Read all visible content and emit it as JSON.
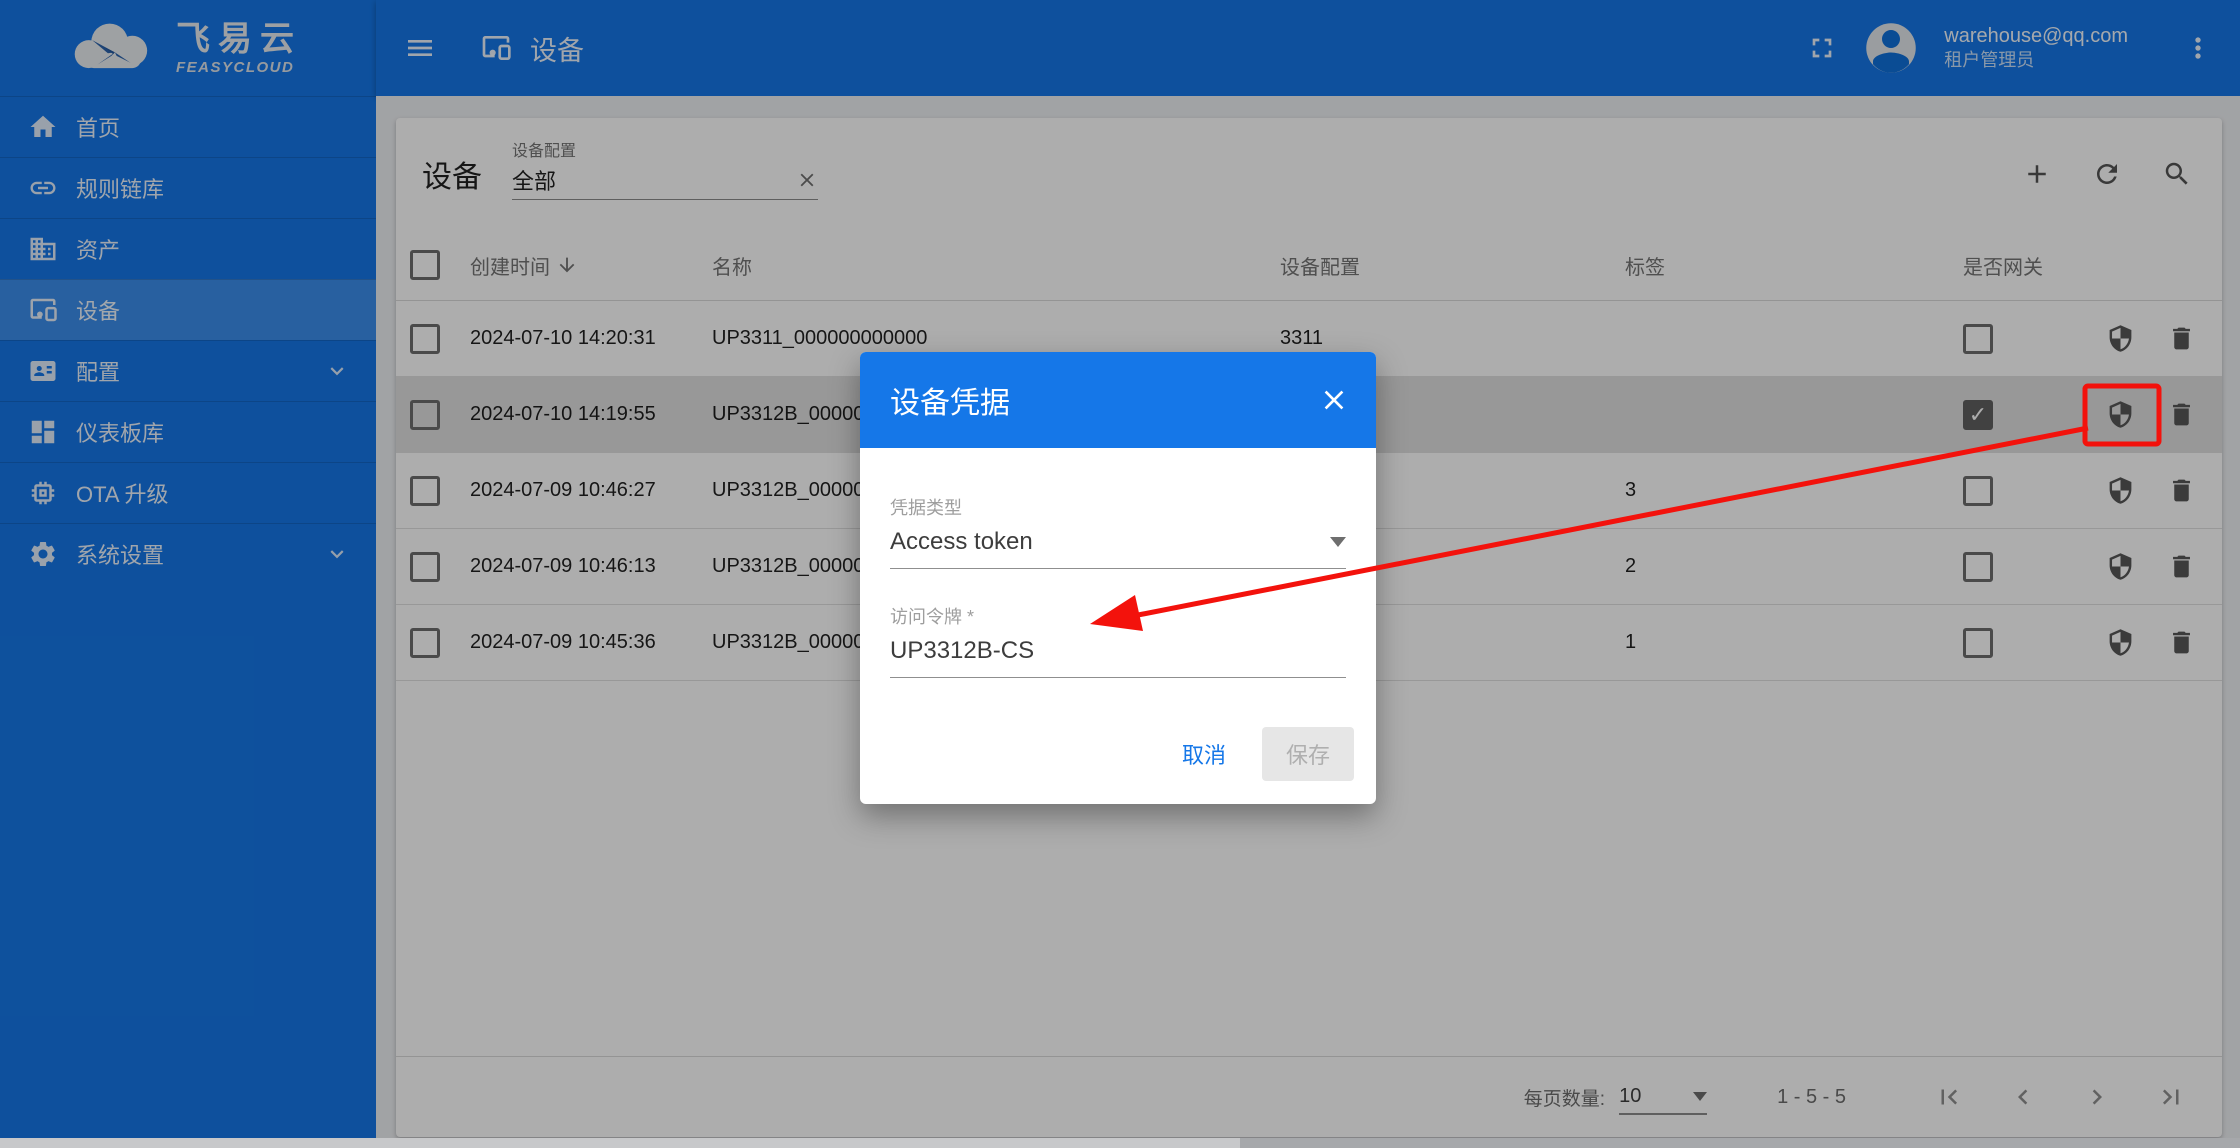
{
  "colors": {
    "primary": "#1577E8",
    "backdrop": "rgba(0,0,0,0.32)",
    "annotation_red": "#F3120C",
    "selected_row": "#E0E0E0"
  },
  "brand": {
    "logo_cn": "飞易云",
    "logo_en": "FEASYCLOUD"
  },
  "topbar": {
    "title": "设备",
    "user": {
      "email": "warehouse@qq.com",
      "role": "租户管理员"
    }
  },
  "sidebar": {
    "items": [
      {
        "label": "首页",
        "icon": "home-icon",
        "active": false,
        "expandable": false
      },
      {
        "label": "规则链库",
        "icon": "link-icon",
        "active": false,
        "expandable": false
      },
      {
        "label": "资产",
        "icon": "domain-icon",
        "active": false,
        "expandable": false
      },
      {
        "label": "设备",
        "icon": "devices-icon",
        "active": true,
        "expandable": false
      },
      {
        "label": "配置",
        "icon": "badge-icon",
        "active": false,
        "expandable": true
      },
      {
        "label": "仪表板库",
        "icon": "dashboard-icon",
        "active": false,
        "expandable": false
      },
      {
        "label": "OTA 升级",
        "icon": "memory-icon",
        "active": false,
        "expandable": false
      },
      {
        "label": "系统设置",
        "icon": "settings-icon",
        "active": false,
        "expandable": true
      }
    ]
  },
  "main": {
    "title": "设备",
    "filter": {
      "label": "设备配置",
      "value": "全部"
    },
    "table": {
      "columns": {
        "created": "创建时间",
        "name": "名称",
        "profile": "设备配置",
        "label": "标签",
        "gateway": "是否网关"
      },
      "sort_column": "创建时间",
      "rows": [
        {
          "created": "2024-07-10 14:20:31",
          "name": "UP3311_000000000000",
          "profile": "3311",
          "label": "",
          "gateway": false,
          "selected": false
        },
        {
          "created": "2024-07-10 14:19:55",
          "name": "UP3312B_00000",
          "profile": "",
          "label": "",
          "gateway": true,
          "selected": true
        },
        {
          "created": "2024-07-09 10:46:27",
          "name": "UP3312B_00000",
          "profile": "",
          "label": "3",
          "gateway": false,
          "selected": false
        },
        {
          "created": "2024-07-09 10:46:13",
          "name": "UP3312B_00000",
          "profile": "",
          "label": "2",
          "gateway": false,
          "selected": false
        },
        {
          "created": "2024-07-09 10:45:36",
          "name": "UP3312B_00000",
          "profile": "",
          "label": "1",
          "gateway": false,
          "selected": false
        }
      ]
    },
    "pagination": {
      "page_size_label": "每页数量:",
      "page_size": "10",
      "range": "1 - 5 - 5"
    }
  },
  "dialog": {
    "title": "设备凭据",
    "fields": {
      "type_label": "凭据类型",
      "type_value": "Access token",
      "token_label": "访问令牌 *",
      "token_value": "UP3312B-CS"
    },
    "buttons": {
      "cancel": "取消",
      "save": "保存"
    }
  }
}
